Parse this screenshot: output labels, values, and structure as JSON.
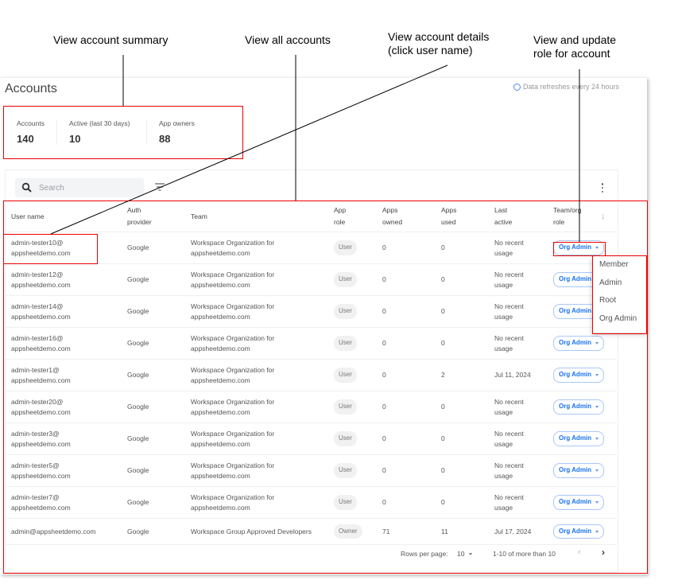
{
  "annotations": {
    "summary": "View account summary",
    "all_accounts": "View all accounts",
    "details_line1": "View account details",
    "details_line2": "(click user name)",
    "role_line1": "View and update",
    "role_line2": "role for account"
  },
  "page": {
    "title": "Accounts",
    "refresh_note": "Data refreshes every 24 hours"
  },
  "summary": [
    {
      "label": "Accounts",
      "value": "140"
    },
    {
      "label": "Active (last 30 days)",
      "value": "10"
    },
    {
      "label": "App owners",
      "value": "88"
    }
  ],
  "toolbar": {
    "search_placeholder": "Search"
  },
  "table": {
    "headers": {
      "user_name": "User name",
      "auth_l1": "Auth",
      "auth_l2": "provider",
      "team": "Team",
      "app_role_l1": "App",
      "app_role_l2": "role",
      "owned_l1": "Apps",
      "owned_l2": "owned",
      "used_l1": "Apps",
      "used_l2": "used",
      "last_l1": "Last",
      "last_l2": "active",
      "role_l1": "Team/org",
      "role_l2": "role"
    },
    "rows": [
      {
        "user1": "admin-tester10@",
        "user2": "appsheetdemo.com",
        "auth": "Google",
        "team1": "Workspace Organization for",
        "team2": "appsheetdemo.com",
        "app_role": "User",
        "owned": "0",
        "used": "0",
        "last1": "No recent",
        "last2": "usage",
        "role": "Org Admin"
      },
      {
        "user1": "admin-tester12@",
        "user2": "appsheetdemo.com",
        "auth": "Google",
        "team1": "Workspace Organization for",
        "team2": "appsheetdemo.com",
        "app_role": "User",
        "owned": "0",
        "used": "0",
        "last1": "No recent",
        "last2": "usage",
        "role": "Org Admin"
      },
      {
        "user1": "admin-tester14@",
        "user2": "appsheetdemo.com",
        "auth": "Google",
        "team1": "Workspace Organization for",
        "team2": "appsheetdemo.com",
        "app_role": "User",
        "owned": "0",
        "used": "0",
        "last1": "No recent",
        "last2": "usage",
        "role": "Org Admin"
      },
      {
        "user1": "admin-tester16@",
        "user2": "appsheetdemo.com",
        "auth": "Google",
        "team1": "Workspace Organization for",
        "team2": "appsheetdemo.com",
        "app_role": "User",
        "owned": "0",
        "used": "0",
        "last1": "No recent",
        "last2": "usage",
        "role": "Org Admin"
      },
      {
        "user1": "admin-tester1@",
        "user2": "appsheetdemo.com",
        "auth": "Google",
        "team1": "Workspace Organization for",
        "team2": "appsheetdemo.com",
        "app_role": "User",
        "owned": "0",
        "used": "2",
        "last1": "Jul 11, 2024",
        "last2": "",
        "role": "Org Admin"
      },
      {
        "user1": "admin-tester20@",
        "user2": "appsheetdemo.com",
        "auth": "Google",
        "team1": "Workspace Organization for",
        "team2": "appsheetdemo.com",
        "app_role": "User",
        "owned": "0",
        "used": "0",
        "last1": "No recent",
        "last2": "usage",
        "role": "Org Admin"
      },
      {
        "user1": "admin-tester3@",
        "user2": "appsheetdemo.com",
        "auth": "Google",
        "team1": "Workspace Organization for",
        "team2": "appsheetdemo.com",
        "app_role": "User",
        "owned": "0",
        "used": "0",
        "last1": "No recent",
        "last2": "usage",
        "role": "Org Admin"
      },
      {
        "user1": "admin-tester5@",
        "user2": "appsheetdemo.com",
        "auth": "Google",
        "team1": "Workspace Organization for",
        "team2": "appsheetdemo.com",
        "app_role": "User",
        "owned": "0",
        "used": "0",
        "last1": "No recent",
        "last2": "usage",
        "role": "Org Admin"
      },
      {
        "user1": "admin-tester7@",
        "user2": "appsheetdemo.com",
        "auth": "Google",
        "team1": "Workspace Organization for",
        "team2": "appsheetdemo.com",
        "app_role": "User",
        "owned": "0",
        "used": "0",
        "last1": "No recent",
        "last2": "usage",
        "role": "Org Admin"
      },
      {
        "user1": "admin@appsheetdemo.com",
        "user2": "",
        "auth": "Google",
        "team1": "Workspace Group Approved Developers",
        "team2": "",
        "app_role": "Owner",
        "owned": "71",
        "used": "11",
        "last1": "Jul 17, 2024",
        "last2": "",
        "role": "Org Admin"
      }
    ]
  },
  "pagination": {
    "rows_per_page_label": "Rows per page:",
    "rows_per_page_value": "10",
    "range": "1-10 of more than 10"
  },
  "role_dropdown": {
    "options": [
      "Member",
      "Admin",
      "Root",
      "Org Admin"
    ]
  }
}
